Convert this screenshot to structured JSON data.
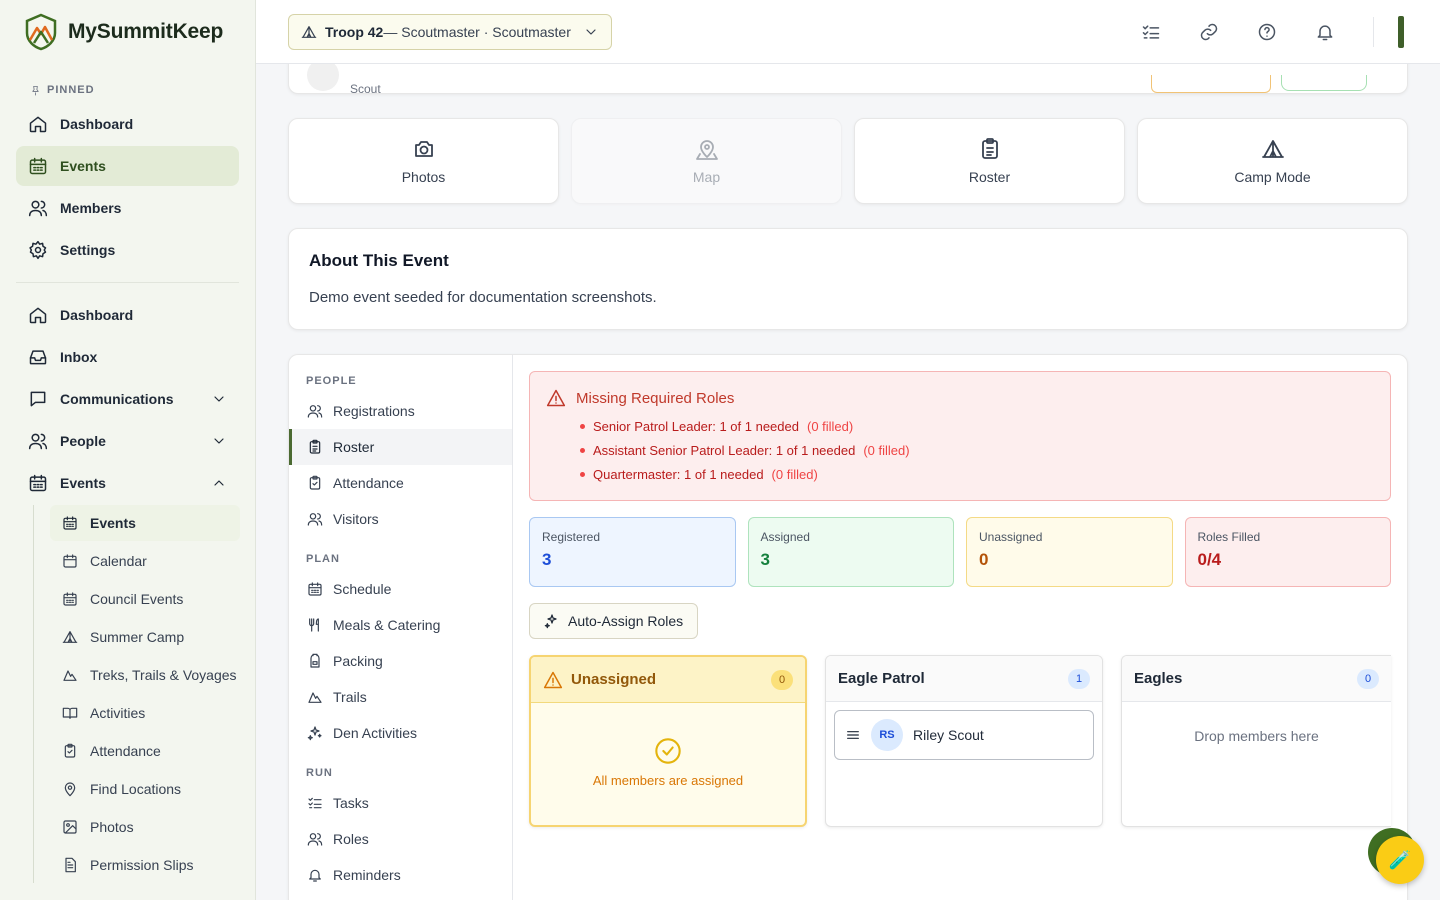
{
  "app": {
    "name": "MySummitKeep"
  },
  "sidebar": {
    "pinned_heading": "PINNED",
    "pinned": [
      {
        "label": "Dashboard",
        "icon": "home-icon"
      },
      {
        "label": "Events",
        "icon": "calendar-icon",
        "active": true
      },
      {
        "label": "Members",
        "icon": "users-icon"
      },
      {
        "label": "Settings",
        "icon": "gear-icon"
      }
    ],
    "main": [
      {
        "label": "Dashboard",
        "icon": "home-icon"
      },
      {
        "label": "Inbox",
        "icon": "inbox-icon"
      },
      {
        "label": "Communications",
        "icon": "message-icon",
        "expandable": true
      },
      {
        "label": "People",
        "icon": "users-icon",
        "expandable": true
      },
      {
        "label": "Events",
        "icon": "calendar-icon",
        "expanded": true
      }
    ],
    "events_sub": [
      {
        "label": "Events",
        "icon": "calendar-icon",
        "active": true
      },
      {
        "label": "Calendar",
        "icon": "calendar-icon"
      },
      {
        "label": "Council Events",
        "icon": "calendar-icon"
      },
      {
        "label": "Summer Camp",
        "icon": "tent-icon"
      },
      {
        "label": "Treks, Trails & Voyages",
        "icon": "mountain-icon"
      },
      {
        "label": "Activities",
        "icon": "book-icon"
      },
      {
        "label": "Attendance",
        "icon": "clipboard-icon"
      },
      {
        "label": "Find Locations",
        "icon": "map-pin-icon"
      },
      {
        "label": "Photos",
        "icon": "image-icon"
      },
      {
        "label": "Permission Slips",
        "icon": "file-icon"
      }
    ]
  },
  "header": {
    "troop_name": "Troop 42",
    "troop_role": " — Scoutmaster · Scoutmaster"
  },
  "event": {
    "subtitle_role": "Scout",
    "tiles": [
      {
        "label": "Photos",
        "icon": "camera-icon"
      },
      {
        "label": "Map",
        "icon": "map-pin-icon",
        "disabled": true
      },
      {
        "label": "Roster",
        "icon": "clipboard-icon"
      },
      {
        "label": "Camp Mode",
        "icon": "tent-icon"
      }
    ],
    "about_title": "About This Event",
    "about_text": "Demo event seeded for documentation screenshots."
  },
  "subnav": {
    "sections": [
      {
        "heading": "PEOPLE",
        "items": [
          {
            "label": "Registrations",
            "icon": "users-icon"
          },
          {
            "label": "Roster",
            "icon": "clipboard-icon",
            "active": true
          },
          {
            "label": "Attendance",
            "icon": "clipboard-icon"
          },
          {
            "label": "Visitors",
            "icon": "users-icon"
          }
        ]
      },
      {
        "heading": "PLAN",
        "items": [
          {
            "label": "Schedule",
            "icon": "calendar-icon"
          },
          {
            "label": "Meals & Catering",
            "icon": "utensils-icon"
          },
          {
            "label": "Packing",
            "icon": "backpack-icon"
          },
          {
            "label": "Trails",
            "icon": "mountain-icon"
          },
          {
            "label": "Den Activities",
            "icon": "sparkles-icon"
          }
        ]
      },
      {
        "heading": "RUN",
        "items": [
          {
            "label": "Tasks",
            "icon": "list-check-icon"
          },
          {
            "label": "Roles",
            "icon": "users-icon"
          },
          {
            "label": "Reminders",
            "icon": "bell-icon"
          }
        ]
      }
    ]
  },
  "roster": {
    "alert": {
      "title": "Missing Required Roles",
      "items": [
        {
          "text": "Senior Patrol Leader: 1 of 1 needed",
          "filled": "(0 filled)"
        },
        {
          "text": "Assistant Senior Patrol Leader: 1 of 1 needed",
          "filled": "(0 filled)"
        },
        {
          "text": "Quartermaster: 1 of 1 needed",
          "filled": "(0 filled)"
        }
      ]
    },
    "stats": [
      {
        "label": "Registered",
        "value": "3",
        "bg": "#eef5ff",
        "border": "#a9c8f2",
        "color": "#1d4ed8"
      },
      {
        "label": "Assigned",
        "value": "3",
        "bg": "#edfbf1",
        "border": "#aee3bd",
        "color": "#15803d"
      },
      {
        "label": "Unassigned",
        "value": "0",
        "bg": "#fffbea",
        "border": "#f4da86",
        "color": "#b45309"
      },
      {
        "label": "Roles Filled",
        "value": "0/4",
        "bg": "#fdeeee",
        "border": "#f5b5b5",
        "color": "#b91c1c"
      }
    ],
    "auto_assign_label": "Auto-Assign Roles",
    "columns": [
      {
        "title": "Unassigned",
        "count": "0",
        "empty_text": "All members are assigned"
      },
      {
        "title": "Eagle Patrol",
        "count": "1",
        "members": [
          {
            "initials": "RS",
            "name": "Riley Scout"
          }
        ]
      },
      {
        "title": "Eagles",
        "count": "0",
        "drop_text": "Drop members here"
      }
    ]
  }
}
